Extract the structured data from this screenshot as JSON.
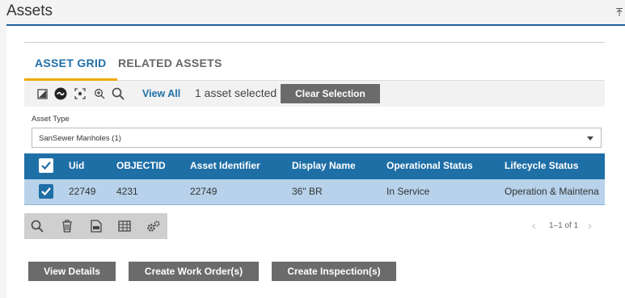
{
  "header": {
    "title": "Assets",
    "collapse_icon": "collapse-up-icon"
  },
  "tabs": [
    {
      "label": "ASSET GRID",
      "active": true
    },
    {
      "label": "RELATED ASSETS",
      "active": false
    }
  ],
  "toolbar": {
    "icons": [
      "image-edit-icon",
      "link-icon",
      "focus-icon",
      "zoom-in-icon",
      "search-icon"
    ],
    "view_all_label": "View All",
    "selection_text": "1 asset selected",
    "clear_selection_label": "Clear Selection"
  },
  "asset_type": {
    "label": "Asset Type",
    "value": "SanSewer Manholes (1)"
  },
  "grid": {
    "columns": [
      "Uid",
      "OBJECTID",
      "Asset Identifier",
      "Display Name",
      "Operational Status",
      "Lifecycle Status"
    ],
    "rows": [
      {
        "selected": true,
        "cells": [
          "22749",
          "4231",
          "22749",
          "36\" BR",
          "In Service",
          "Operation & Maintena"
        ]
      }
    ],
    "header_color": "#1f6fa7",
    "selected_row_color": "#b7d2ea"
  },
  "grid_toolbar": {
    "icons": [
      "search-icon",
      "trash-icon",
      "export-icon",
      "table-icon",
      "settings-icon"
    ]
  },
  "pager": {
    "text": "1–1 of 1"
  },
  "actions": {
    "view_details": "View Details",
    "create_work_orders": "Create Work Order(s)",
    "create_inspections": "Create Inspection(s)"
  },
  "colors": {
    "accent": "#1f6fa7",
    "tab_underline": "#f0a800",
    "button": "#6b6b6b"
  }
}
